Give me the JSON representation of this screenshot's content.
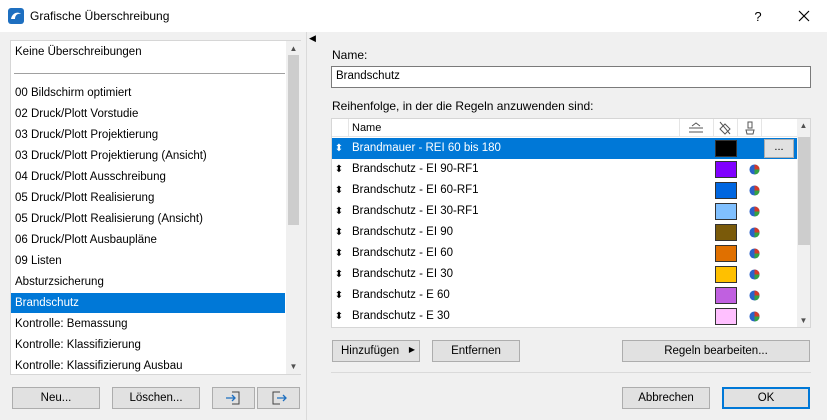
{
  "window": {
    "title": "Grafische Überschreibung",
    "help": "?",
    "close": "✕"
  },
  "left": {
    "items": [
      "Keine Überschreibungen",
      "00 Bildschirm optimiert",
      "02 Druck/Plott Vorstudie",
      "03 Druck/Plott Projektierung",
      "03 Druck/Plott Projektierung (Ansicht)",
      "04 Druck/Plott Ausschreibung",
      "05 Druck/Plott Realisierung",
      "05 Druck/Plott Realisierung (Ansicht)",
      "06 Druck/Plott Ausbaupläne",
      "09 Listen",
      "Absturzsicherung",
      "Brandschutz",
      "Kontrolle: Bemassung",
      "Kontrolle: Klassifizierung",
      "Kontrolle: Klassifizierung Ausbau"
    ],
    "selected_index": 11,
    "new_btn": "Neu...",
    "delete_btn": "Löschen...",
    "import_icon": "import-icon",
    "export_icon": "export-icon"
  },
  "right": {
    "name_label": "Name:",
    "name_value": "Brandschutz",
    "order_label": "Reihenfolge, in der die Regeln anzuwenden sind:",
    "col_name": "Name",
    "col_icons": [
      "line-style-icon",
      "fill-icon",
      "surface-icon"
    ],
    "rules": [
      {
        "name": "Brandmauer - REI 60 bis 180",
        "color": "#000000",
        "pie": false,
        "selected": true,
        "more": "..."
      },
      {
        "name": "Brandschutz - EI 90-RF1",
        "color": "#8000ff",
        "pie": true
      },
      {
        "name": "Brandschutz - EI 60-RF1",
        "color": "#0066e0",
        "pie": true
      },
      {
        "name": "Brandschutz - EI 30-RF1",
        "color": "#80c0ff",
        "pie": true
      },
      {
        "name": "Brandschutz - EI 90",
        "color": "#7a5a0a",
        "pie": true
      },
      {
        "name": "Brandschutz - EI 60",
        "color": "#e07000",
        "pie": true
      },
      {
        "name": "Brandschutz - EI 30",
        "color": "#ffc000",
        "pie": true
      },
      {
        "name": "Brandschutz - E 60",
        "color": "#c060e0",
        "pie": true
      },
      {
        "name": "Brandschutz - E 30",
        "color": "#ffc0ff",
        "pie": true
      }
    ],
    "add_btn": "Hinzufügen",
    "remove_btn": "Entfernen",
    "edit_rules_btn": "Regeln bearbeiten...",
    "cancel_btn": "Abbrechen",
    "ok_btn": "OK"
  }
}
